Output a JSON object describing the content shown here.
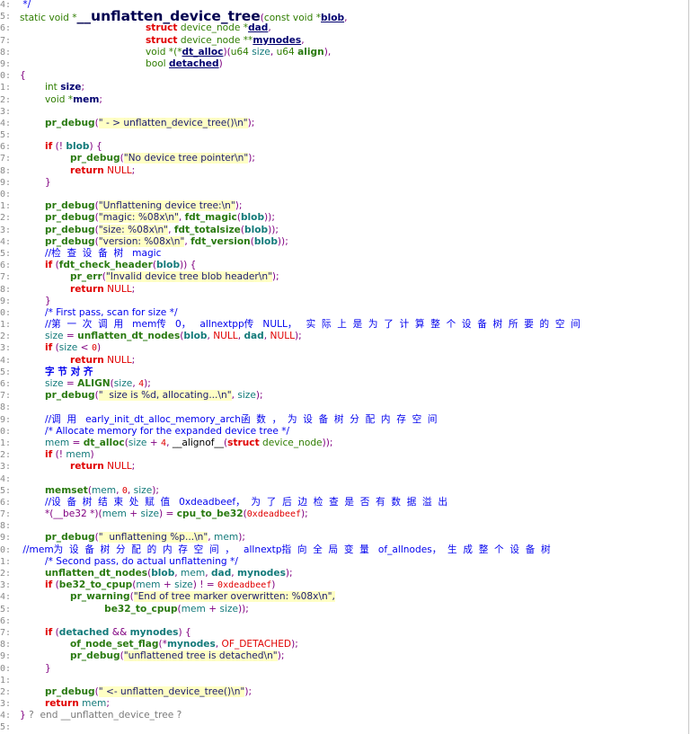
{
  "line_numbers": [
    "4:",
    "5:",
    "6:",
    "7:",
    "8:",
    "9:",
    "0:",
    "1:",
    "2:",
    "3:",
    "4:",
    "5:",
    "6:",
    "7:",
    "8:",
    "9:",
    "0:",
    "1:",
    "2:",
    "3:",
    "4:",
    "5:",
    "6:",
    "7:",
    "8:",
    "9:",
    "0:",
    "1:",
    "2:",
    "3:",
    "4:",
    "5:",
    "6:",
    "7:",
    "8:",
    "9:",
    "0:",
    "1:",
    "2:",
    "3:",
    "4:",
    "5:",
    "6:",
    "7:",
    "8:",
    "9:",
    "0:",
    "1:",
    "2:",
    "3:",
    "4:",
    "5:",
    "6:",
    "7:",
    "8:",
    "9:",
    "0:",
    "1:",
    "2:",
    "3:",
    "4:",
    "5:"
  ],
  "lines": [
    [
      [
        " */",
        "cm"
      ]
    ],
    [
      [
        "static void *",
        "ty"
      ],
      [
        "__unflatten_device_tree",
        "fnbig"
      ],
      [
        "(",
        "p"
      ],
      [
        "const void *",
        "ty"
      ],
      [
        "blob",
        "par"
      ],
      [
        ",",
        "p"
      ]
    ],
    [
      [
        "\t\t\t\t\t",
        ""
      ],
      [
        "struct",
        "kw"
      ],
      [
        " device_node *",
        "ty"
      ],
      [
        "dad",
        "par"
      ],
      [
        ",",
        "p"
      ]
    ],
    [
      [
        "\t\t\t\t\t",
        ""
      ],
      [
        "struct",
        "kw"
      ],
      [
        " device_node **",
        "ty"
      ],
      [
        "mynodes",
        "par"
      ],
      [
        ",",
        "p"
      ]
    ],
    [
      [
        "\t\t\t\t\t",
        ""
      ],
      [
        "void *(*",
        "ty"
      ],
      [
        "dt_alloc",
        "par"
      ],
      [
        ")(",
        "p"
      ],
      [
        "u64 ",
        "ty"
      ],
      [
        "size",
        "v"
      ],
      [
        ", ",
        "p"
      ],
      [
        "u64 ",
        "ty"
      ],
      [
        "align",
        "fn"
      ],
      [
        "),",
        "p"
      ]
    ],
    [
      [
        "\t\t\t\t\t",
        ""
      ],
      [
        "bool ",
        "ty"
      ],
      [
        "detached",
        "par"
      ],
      [
        ")",
        "p"
      ]
    ],
    [
      [
        "{",
        "p"
      ]
    ],
    [
      [
        "\t",
        ""
      ],
      [
        "int ",
        "ty"
      ],
      [
        "size",
        "vd"
      ],
      [
        ";",
        "p"
      ]
    ],
    [
      [
        "\t",
        ""
      ],
      [
        "void *",
        "ty"
      ],
      [
        "mem",
        "vd"
      ],
      [
        ";",
        "p"
      ]
    ],
    [],
    [
      [
        "\t",
        ""
      ],
      [
        "pr_debug",
        "fn"
      ],
      [
        "(",
        "p"
      ],
      [
        "\" - > unflatten_device_tree()\\n\"",
        "str"
      ],
      [
        ");",
        "p"
      ]
    ],
    [],
    [
      [
        "\t",
        ""
      ],
      [
        "if",
        "kw"
      ],
      [
        " (! ",
        "p"
      ],
      [
        "blob",
        "vb"
      ],
      [
        ") {",
        "p"
      ]
    ],
    [
      [
        "\t\t",
        ""
      ],
      [
        "pr_debug",
        "fn"
      ],
      [
        "(",
        "p"
      ],
      [
        "\"No device tree pointer\\n\"",
        "str"
      ],
      [
        ");",
        "p"
      ]
    ],
    [
      [
        "\t\t",
        ""
      ],
      [
        "return",
        "kw"
      ],
      [
        " ",
        ""
      ],
      [
        "NULL",
        "nl"
      ],
      [
        ";",
        "p"
      ]
    ],
    [
      [
        "\t",
        ""
      ],
      [
        "}",
        "p"
      ]
    ],
    [],
    [
      [
        "\t",
        ""
      ],
      [
        "pr_debug",
        "fn"
      ],
      [
        "(",
        "p"
      ],
      [
        "\"Unflattening device tree:\\n\"",
        "str"
      ],
      [
        ");",
        "p"
      ]
    ],
    [
      [
        "\t",
        ""
      ],
      [
        "pr_debug",
        "fn"
      ],
      [
        "(",
        "p"
      ],
      [
        "\"magic: %08x\\n\"",
        "str"
      ],
      [
        ", ",
        "p"
      ],
      [
        "fdt_magic",
        "fn"
      ],
      [
        "(",
        "p"
      ],
      [
        "blob",
        "vb"
      ],
      [
        "));",
        "p"
      ]
    ],
    [
      [
        "\t",
        ""
      ],
      [
        "pr_debug",
        "fn"
      ],
      [
        "(",
        "p"
      ],
      [
        "\"size: %08x\\n\"",
        "str"
      ],
      [
        ", ",
        "p"
      ],
      [
        "fdt_totalsize",
        "fn"
      ],
      [
        "(",
        "p"
      ],
      [
        "blob",
        "vb"
      ],
      [
        "));",
        "p"
      ]
    ],
    [
      [
        "\t",
        ""
      ],
      [
        "pr_debug",
        "fn"
      ],
      [
        "(",
        "p"
      ],
      [
        "\"version: %08x\\n\"",
        "str"
      ],
      [
        ", ",
        "p"
      ],
      [
        "fdt_version",
        "fn"
      ],
      [
        "(",
        "p"
      ],
      [
        "blob",
        "vb"
      ],
      [
        "));",
        "p"
      ]
    ],
    [
      [
        "\t",
        ""
      ],
      [
        "//检  查  设  备  树   magic",
        "cm"
      ]
    ],
    [
      [
        "\t",
        ""
      ],
      [
        "if",
        "kw"
      ],
      [
        " (",
        "p"
      ],
      [
        "fdt_check_header",
        "fn"
      ],
      [
        "(",
        "p"
      ],
      [
        "blob",
        "vb"
      ],
      [
        ")) {",
        "p"
      ]
    ],
    [
      [
        "\t\t",
        ""
      ],
      [
        "pr_err",
        "fn"
      ],
      [
        "(",
        "p"
      ],
      [
        "\"Invalid device tree blob header\\n\"",
        "str"
      ],
      [
        ");",
        "p"
      ]
    ],
    [
      [
        "\t\t",
        ""
      ],
      [
        "return",
        "kw"
      ],
      [
        " ",
        ""
      ],
      [
        "NULL",
        "nl"
      ],
      [
        ";",
        "p"
      ]
    ],
    [
      [
        "\t",
        ""
      ],
      [
        "}",
        "p"
      ]
    ],
    [
      [
        "\t",
        ""
      ],
      [
        "/* First pass, scan for size */",
        "cm"
      ]
    ],
    [
      [
        "\t",
        ""
      ],
      [
        "//第  一  次  调  用   mem传   0，   allnextpp传   NULL，   实  际  上  是  为  了  计  算  整  个  设  备  树  所  要  的  空  间",
        "cm"
      ]
    ],
    [
      [
        "\t",
        ""
      ],
      [
        "size",
        "v"
      ],
      [
        " = ",
        "p"
      ],
      [
        "unflatten_dt_nodes",
        "fn"
      ],
      [
        "(",
        "p"
      ],
      [
        "blob",
        "vb"
      ],
      [
        ", ",
        "p"
      ],
      [
        "NULL",
        "nl"
      ],
      [
        ", ",
        "p"
      ],
      [
        "dad",
        "vb"
      ],
      [
        ", ",
        "p"
      ],
      [
        "NULL",
        "nl"
      ],
      [
        ");",
        "p"
      ]
    ],
    [
      [
        "\t",
        ""
      ],
      [
        "if",
        "kw"
      ],
      [
        " (",
        "p"
      ],
      [
        "size",
        "v"
      ],
      [
        " < ",
        "p"
      ],
      [
        "0",
        "num-lit"
      ],
      [
        ")",
        "p"
      ]
    ],
    [
      [
        "\t\t",
        ""
      ],
      [
        "return",
        "kw"
      ],
      [
        " ",
        ""
      ],
      [
        "NULL",
        "nl"
      ],
      [
        ";",
        "p"
      ]
    ],
    [
      [
        "\t",
        ""
      ],
      [
        "字 节 对 齐",
        "cmb"
      ]
    ],
    [
      [
        "\t",
        ""
      ],
      [
        "size",
        "v"
      ],
      [
        " = ",
        "p"
      ],
      [
        "ALIGN",
        "fn"
      ],
      [
        "(",
        "p"
      ],
      [
        "size",
        "v"
      ],
      [
        ", ",
        "p"
      ],
      [
        "4",
        "num-lit"
      ],
      [
        ");",
        "p"
      ]
    ],
    [
      [
        "\t",
        ""
      ],
      [
        "pr_debug",
        "fn"
      ],
      [
        "(",
        "p"
      ],
      [
        "\"  size is %d, allocating...\\n\"",
        "str"
      ],
      [
        ", ",
        "p"
      ],
      [
        "size",
        "v"
      ],
      [
        ");",
        "p"
      ]
    ],
    [],
    [
      [
        "\t",
        ""
      ],
      [
        "//调  用   early_init_dt_alloc_memory_arch函  数  ，  为  设  备  树  分  配  内  存  空  间",
        "cm"
      ]
    ],
    [
      [
        "\t",
        ""
      ],
      [
        "/* Allocate memory for the expanded device tree */",
        "cm"
      ]
    ],
    [
      [
        "\t",
        ""
      ],
      [
        "mem",
        "v"
      ],
      [
        " = ",
        "p"
      ],
      [
        "dt_alloc",
        "fn"
      ],
      [
        "(",
        "p"
      ],
      [
        "size",
        "v"
      ],
      [
        " + ",
        "p"
      ],
      [
        "4",
        "num-lit"
      ],
      [
        ", ",
        "p"
      ],
      [
        "__alignof__",
        "pl"
      ],
      [
        "(",
        "p"
      ],
      [
        "struct",
        "kw"
      ],
      [
        " device_node",
        "ty"
      ],
      [
        "));",
        "p"
      ]
    ],
    [
      [
        "\t",
        ""
      ],
      [
        "if",
        "kw"
      ],
      [
        " (! ",
        "p"
      ],
      [
        "mem",
        "v"
      ],
      [
        ")",
        "p"
      ]
    ],
    [
      [
        "\t\t",
        ""
      ],
      [
        "return",
        "kw"
      ],
      [
        " ",
        ""
      ],
      [
        "NULL",
        "nl"
      ],
      [
        ";",
        "p"
      ]
    ],
    [],
    [
      [
        "\t",
        ""
      ],
      [
        "memset",
        "fn"
      ],
      [
        "(",
        "p"
      ],
      [
        "mem",
        "v"
      ],
      [
        ", ",
        "p"
      ],
      [
        "0",
        "num-lit"
      ],
      [
        ", ",
        "p"
      ],
      [
        "size",
        "v"
      ],
      [
        ");",
        "p"
      ]
    ],
    [
      [
        "\t",
        ""
      ],
      [
        "//设  备  树  结  束  处  赋  值   0xdeadbeef，  为  了  后  边  检  查  是  否  有  数  据  溢  出",
        "cm"
      ]
    ],
    [
      [
        "\t",
        ""
      ],
      [
        "*(__be32 *)(",
        "p"
      ],
      [
        "mem",
        "v"
      ],
      [
        " + ",
        "p"
      ],
      [
        "size",
        "v"
      ],
      [
        ") = ",
        "p"
      ],
      [
        "cpu_to_be32",
        "fn"
      ],
      [
        "(",
        "p"
      ],
      [
        "0xdeadbeef",
        "num-lit"
      ],
      [
        ");",
        "p"
      ]
    ],
    [],
    [
      [
        "\t",
        ""
      ],
      [
        "pr_debug",
        "fn"
      ],
      [
        "(",
        "p"
      ],
      [
        "\"  unflattening %p...\\n\"",
        "str"
      ],
      [
        ", ",
        "p"
      ],
      [
        "mem",
        "v"
      ],
      [
        ");",
        "p"
      ]
    ],
    [
      [
        " //mem为  设  备  树  分  配  的  内  存  空  间  ，   allnextp指  向  全  局  变  量   of_allnodes，  生  成  整  个  设  备  树",
        "cm"
      ]
    ],
    [
      [
        "\t",
        ""
      ],
      [
        "/* Second pass, do actual unflattening */",
        "cm"
      ]
    ],
    [
      [
        "\t",
        ""
      ],
      [
        "unflatten_dt_nodes",
        "fn"
      ],
      [
        "(",
        "p"
      ],
      [
        "blob",
        "vb"
      ],
      [
        ", ",
        "p"
      ],
      [
        "mem",
        "v"
      ],
      [
        ", ",
        "p"
      ],
      [
        "dad",
        "vb"
      ],
      [
        ", ",
        "p"
      ],
      [
        "mynodes",
        "vb"
      ],
      [
        ");",
        "p"
      ]
    ],
    [
      [
        "\t",
        ""
      ],
      [
        "if",
        "kw"
      ],
      [
        " (",
        "p"
      ],
      [
        "be32_to_cpup",
        "fn"
      ],
      [
        "(",
        "p"
      ],
      [
        "mem",
        "v"
      ],
      [
        " + ",
        "p"
      ],
      [
        "size",
        "v"
      ],
      [
        ") ! = ",
        "p"
      ],
      [
        "0xdeadbeef",
        "num-lit"
      ],
      [
        ")",
        "p"
      ]
    ],
    [
      [
        "\t\t",
        ""
      ],
      [
        "pr_warning",
        "fn"
      ],
      [
        "(",
        "p"
      ],
      [
        "\"End of tree marker overwritten: %08x\\n\",",
        "str"
      ]
    ],
    [
      [
        "\t\t\t   ",
        ""
      ],
      [
        "be32_to_cpup",
        "fn"
      ],
      [
        "(",
        "p"
      ],
      [
        "mem",
        "v"
      ],
      [
        " + ",
        "p"
      ],
      [
        "size",
        "v"
      ],
      [
        "));",
        "p"
      ]
    ],
    [],
    [
      [
        "\t",
        ""
      ],
      [
        "if",
        "kw"
      ],
      [
        " (",
        "p"
      ],
      [
        "detached",
        "vb"
      ],
      [
        " && ",
        "p"
      ],
      [
        "mynodes",
        "vb"
      ],
      [
        ") {",
        "p"
      ]
    ],
    [
      [
        "\t\t",
        ""
      ],
      [
        "of_node_set_flag",
        "fn"
      ],
      [
        "(*",
        "p"
      ],
      [
        "mynodes",
        "vb"
      ],
      [
        ", ",
        "p"
      ],
      [
        "OF_DETACHED",
        "nl"
      ],
      [
        ");",
        "p"
      ]
    ],
    [
      [
        "\t\t",
        ""
      ],
      [
        "pr_debug",
        "fn"
      ],
      [
        "(",
        "p"
      ],
      [
        "\"unflattened tree is detached\\n\"",
        "str"
      ],
      [
        ");",
        "p"
      ]
    ],
    [
      [
        "\t",
        ""
      ],
      [
        "}",
        "p"
      ]
    ],
    [],
    [
      [
        "\t",
        ""
      ],
      [
        "pr_debug",
        "fn"
      ],
      [
        "(",
        "p"
      ],
      [
        "\" <- unflatten_device_tree()\\n\"",
        "str"
      ],
      [
        ");",
        "p"
      ]
    ],
    [
      [
        "\t",
        ""
      ],
      [
        "return",
        "kw"
      ],
      [
        " ",
        ""
      ],
      [
        "mem",
        "v"
      ],
      [
        ";",
        "p"
      ]
    ],
    [
      [
        "}",
        "p"
      ],
      [
        " ?  end __unflatten_device_tree ?",
        "gr"
      ]
    ],
    []
  ]
}
